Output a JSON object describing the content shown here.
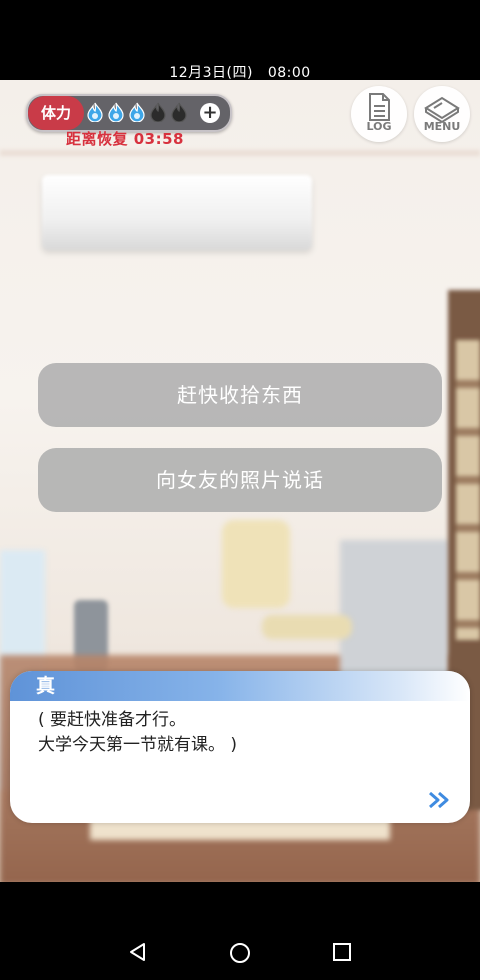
{
  "status_bar": {
    "datetime": "12月3日(四)   08:00"
  },
  "hud": {
    "stamina_label": "体力",
    "flames_full": 3,
    "flames_total": 5,
    "recover_text": "距离恢复 03:58",
    "log_label": "LOG",
    "menu_label": "MENU"
  },
  "choices": [
    "赶快收拾东西",
    "向女友的照片说话"
  ],
  "dialog": {
    "speaker": "真",
    "lines": [
      "( 要赶快准备才行。",
      "大学今天第一节就有课。 )"
    ]
  },
  "colors": {
    "accent_red": "#c93b48",
    "flame_full": "#3ea6e8",
    "flame_empty": "#2b2b2b",
    "dialog_header": "#5f93d8"
  },
  "icons": {
    "nav_back": "back-triangle-icon",
    "nav_home": "home-circle-icon",
    "nav_recent": "recent-square-icon"
  }
}
